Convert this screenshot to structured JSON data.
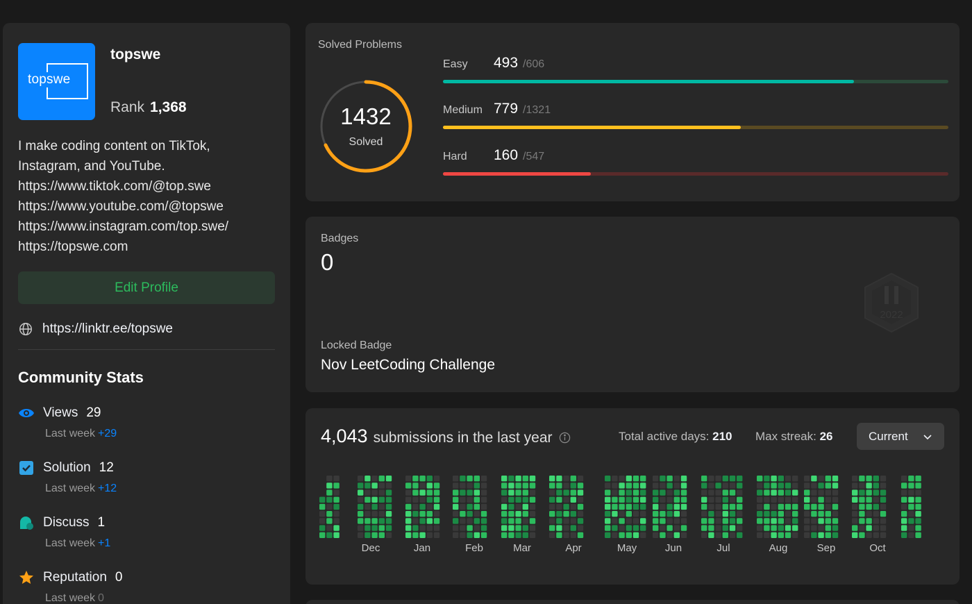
{
  "profile": {
    "avatar_text": "topswe",
    "username": "topswe",
    "rank_label": "Rank",
    "rank_value": "1,368",
    "bio_lines": [
      "I make coding content on TikTok,",
      "Instagram, and YouTube.",
      "https://www.tiktok.com/@top.swe",
      "https://www.youtube.com/@topswe",
      "https://www.instagram.com/top.swe/",
      "https://topswe.com"
    ],
    "edit_button": "Edit Profile",
    "website": "https://linktr.ee/topswe"
  },
  "community": {
    "title": "Community Stats",
    "stats": [
      {
        "label": "Views",
        "value": "29",
        "sub_label": "Last week",
        "delta": "+29",
        "icon": "eye-icon"
      },
      {
        "label": "Solution",
        "value": "12",
        "sub_label": "Last week",
        "delta": "+12",
        "icon": "checkbox-icon"
      },
      {
        "label": "Discuss",
        "value": "1",
        "sub_label": "Last week",
        "delta": "+1",
        "icon": "chat-icon"
      },
      {
        "label": "Reputation",
        "value": "0",
        "sub_label": "Last week",
        "delta": "0",
        "icon": "star-icon"
      }
    ]
  },
  "solved": {
    "title": "Solved Problems",
    "total": "1432",
    "total_label": "Solved",
    "difficulties": [
      {
        "name": "Easy",
        "solved": "493",
        "total": "/606",
        "fraction": 0.8135,
        "color": "#00b8a3",
        "track": "#2c4a3a"
      },
      {
        "name": "Medium",
        "solved": "779",
        "total": "/1321",
        "fraction": 0.5897,
        "color": "#ffc01e",
        "track": "#5a4a22"
      },
      {
        "name": "Hard",
        "solved": "160",
        "total": "/547",
        "fraction": 0.2925,
        "color": "#ef4743",
        "track": "#5a2a2a"
      }
    ]
  },
  "badges": {
    "title": "Badges",
    "count": "0",
    "locked_label": "Locked Badge",
    "locked_name": "Nov LeetCoding Challenge",
    "badge_art_text": "2022"
  },
  "submissions": {
    "count": "4,043",
    "text": "submissions in the last year",
    "active_label": "Total active days:",
    "active_value": "210",
    "streak_label": "Max streak:",
    "streak_value": "26",
    "dropdown_value": "Current",
    "months": [
      "Dec",
      "Jan",
      "Feb",
      "Mar",
      "Apr",
      "May",
      "Jun",
      "Jul",
      "Aug",
      "Sep",
      "Oct"
    ],
    "colors": {
      "empty": "#393939",
      "low": "#0e4429",
      "mid": "#1b8a45",
      "high": "#2cbb5d",
      "top": "#3fd873"
    }
  }
}
